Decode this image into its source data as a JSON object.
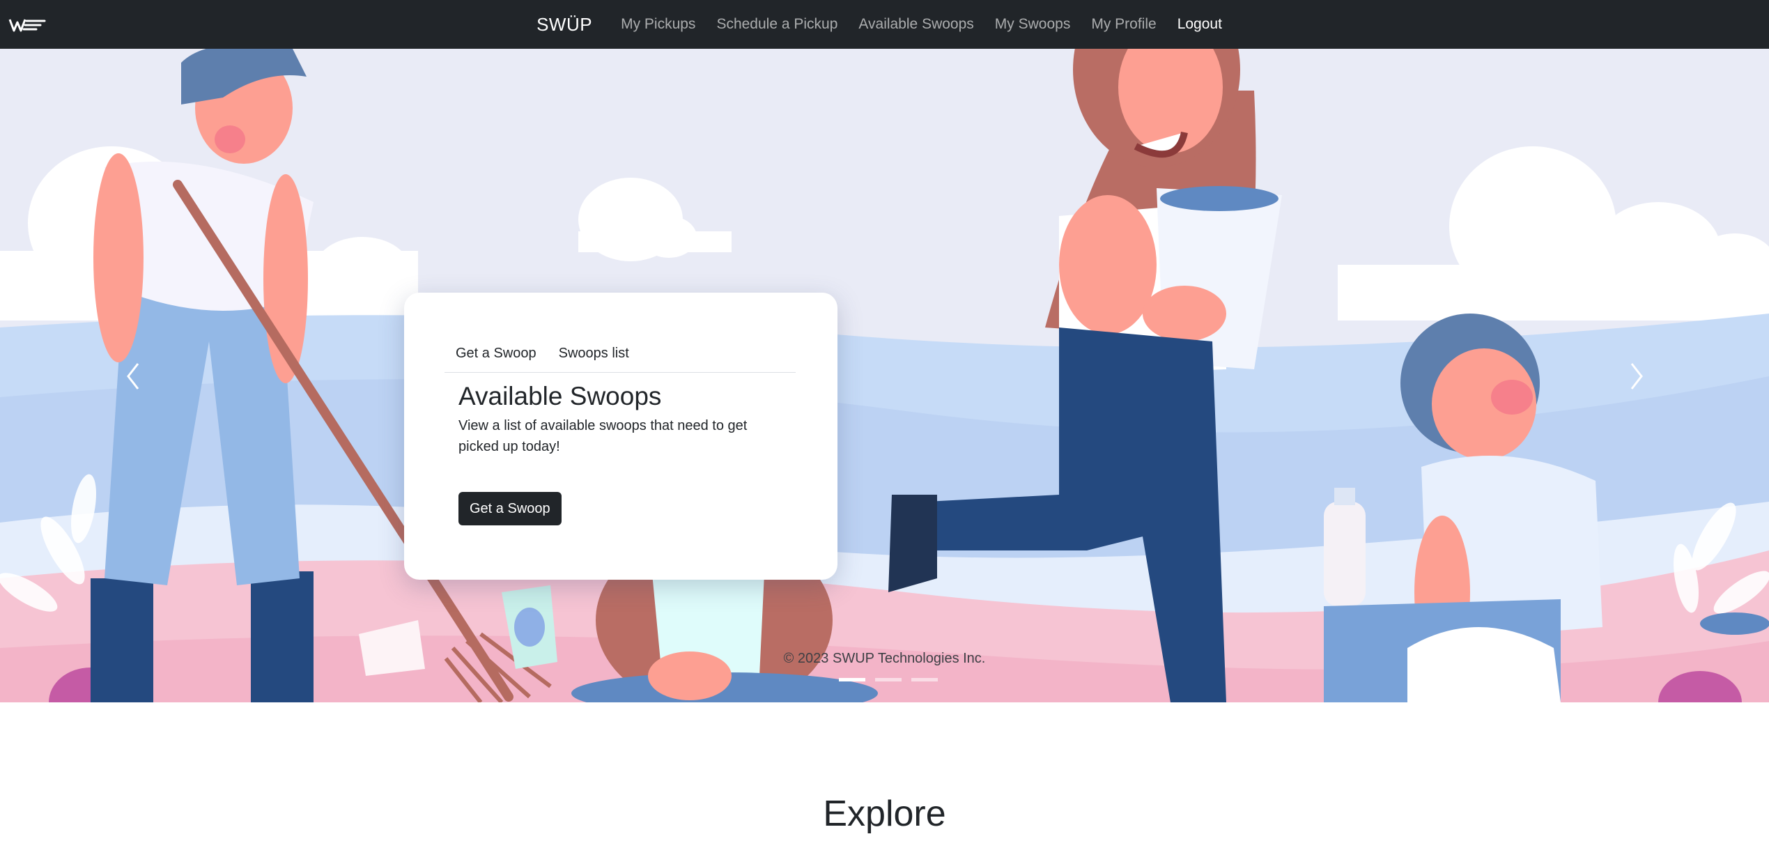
{
  "navbar": {
    "brand": "SWÜP",
    "links": [
      {
        "label": "My Pickups"
      },
      {
        "label": "Schedule a Pickup"
      },
      {
        "label": "Available Swoops"
      },
      {
        "label": "My Swoops"
      },
      {
        "label": "My Profile"
      },
      {
        "label": "Logout"
      }
    ]
  },
  "hero": {
    "card": {
      "tabs": [
        "Get a Swoop",
        "Swoops list"
      ],
      "title": "Available Swoops",
      "text": "View a list of available swoops that need to get picked up today!",
      "button_label": "Get a Swoop"
    },
    "copyright": "© 2023 SWUP Technologies Inc.",
    "slides": 3,
    "active_slide": 1
  },
  "explore": {
    "title": "Explore"
  },
  "colors": {
    "navbar_bg": "#212529",
    "button_bg": "#212529",
    "sky": "#e9ebf6",
    "hill_blue": "#c6dbf7",
    "hill_pink": "#f6c4d3"
  }
}
